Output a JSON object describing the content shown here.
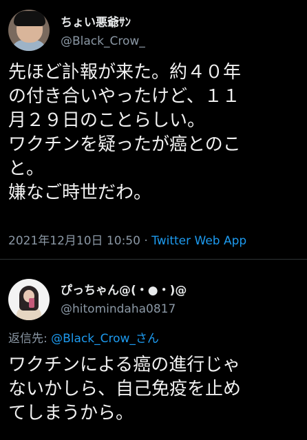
{
  "tweet1": {
    "display_name": "ちょい悪爺ｻﾝ",
    "handle": "@Black_Crow_",
    "text": "先ほど訃報が来た。約４０年\nの付き合いやったけど、１１\n月２９日のことらしい。\nワクチンを疑ったが癌とのこ\nと。\n嫌なご時世だわ。",
    "timestamp": "2021年12月10日 10:50",
    "separator": " · ",
    "source": "Twitter Web App"
  },
  "tweet2": {
    "display_name": "ぴっちゃん@(・●・)@",
    "handle": "@hitomindaha0817",
    "reply_prefix": "返信先: ",
    "reply_to": "@Black_Crow_さん",
    "text": "ワクチンによる癌の進行じゃ\nないかしら、自己免疫を止め\nてしまうから。"
  },
  "colors": {
    "background": "#000000",
    "text": "#e7e9ea",
    "secondary": "#8b98a5",
    "link": "#1d9bf0"
  }
}
